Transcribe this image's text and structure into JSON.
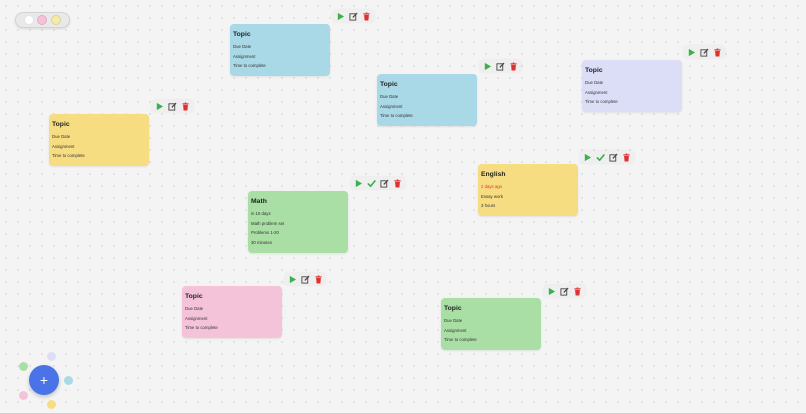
{
  "colors": {
    "blue": "#a9d8e6",
    "yellow": "#f7dd82",
    "green": "#a9dfa4",
    "pink": "#f5c3d9",
    "lavender": "#dcdef8",
    "accent": "#4a73e8",
    "play": "#37b24d",
    "delete": "#e03131",
    "overdue": "#e03131"
  },
  "window_controls": [
    "#ffffff",
    "#f5c3d9",
    "#f7eaa8"
  ],
  "cards": [
    {
      "id": "topic-1",
      "title": "Topic",
      "lines": [
        "Due Date",
        "Assignment",
        "Time to complete"
      ],
      "color": "blue"
    },
    {
      "id": "topic-2",
      "title": "Topic",
      "lines": [
        "Due Date",
        "Assignment",
        "Time to complete"
      ],
      "color": "blue"
    },
    {
      "id": "topic-3",
      "title": "Topic",
      "lines": [
        "Due Date",
        "Assignment",
        "Time to complete"
      ],
      "color": "lavender"
    },
    {
      "id": "topic-4",
      "title": "Topic",
      "lines": [
        "Due Date",
        "Assignment",
        "Time to complete"
      ],
      "color": "yellow"
    },
    {
      "id": "english",
      "title": "English",
      "lines": [
        "2 days ago",
        "Essay work",
        "3 hours"
      ],
      "color": "yellow",
      "overdue_line": 0,
      "completable": true
    },
    {
      "id": "math",
      "title": "Math",
      "lines": [
        "in 10 days",
        "Math problem set",
        "Problems 1-20",
        "30 minutes"
      ],
      "color": "green",
      "completable": true
    },
    {
      "id": "topic-5",
      "title": "Topic",
      "lines": [
        "Due Date",
        "Assignment",
        "Time to complete"
      ],
      "color": "pink"
    },
    {
      "id": "topic-6",
      "title": "Topic",
      "lines": [
        "Due Date",
        "Assignment",
        "Time to complete"
      ],
      "color": "green"
    }
  ],
  "fab_label": "+",
  "palette": [
    {
      "name": "lavender",
      "color": "#dcdef8"
    },
    {
      "name": "green",
      "color": "#a9dfa4"
    },
    {
      "name": "blue",
      "color": "#a9d8e6"
    },
    {
      "name": "pink",
      "color": "#f5c3d9"
    },
    {
      "name": "yellow",
      "color": "#f7dd82"
    }
  ],
  "icons": {
    "play": "play-icon",
    "check": "check-icon",
    "edit": "edit-icon",
    "delete": "trash-icon",
    "add": "plus-icon"
  }
}
